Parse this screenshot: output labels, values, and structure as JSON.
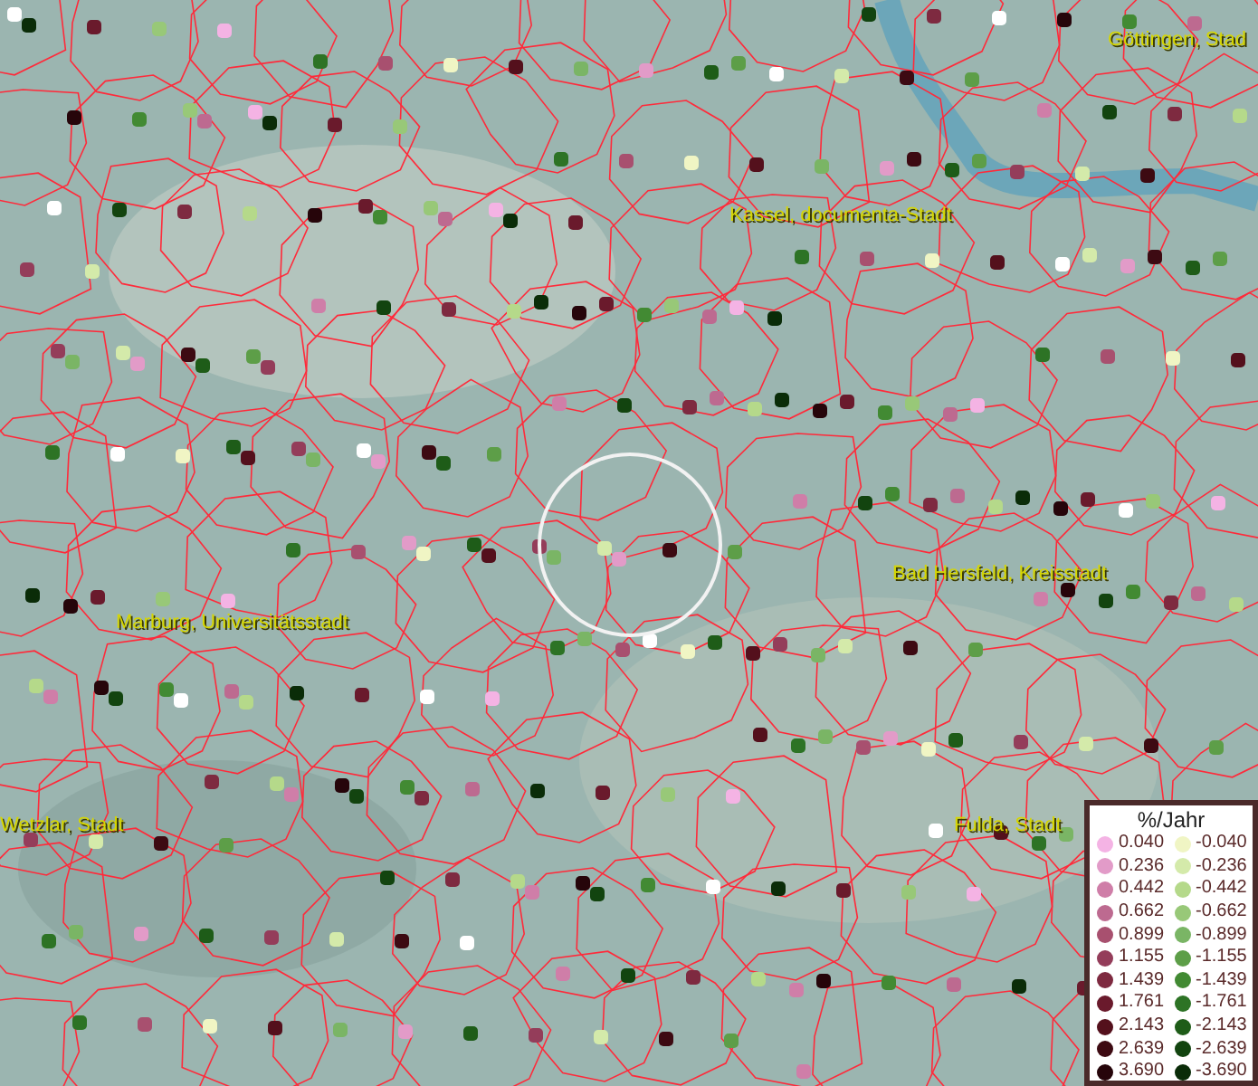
{
  "map": {
    "places": [
      {
        "name": "Göttingen, Stad"
      },
      {
        "name": "Kassel, documenta-Stadt"
      },
      {
        "name": "Marburg, Universitätsstadt"
      },
      {
        "name": "Bad Hersfeld, Kreisstadt"
      },
      {
        "name": "Wetzlar, Stadt"
      },
      {
        "name": "Fulda, Stadt"
      }
    ]
  },
  "legend": {
    "title": "%/Jahr",
    "entries": [
      {
        "label": "0.040",
        "color": "#f4b3e4"
      },
      {
        "label": "-0.040",
        "color": "#f0f5c4"
      },
      {
        "label": "0.236",
        "color": "#e29bc8"
      },
      {
        "label": "-0.236",
        "color": "#d4eaaa"
      },
      {
        "label": "0.442",
        "color": "#cf7ea8"
      },
      {
        "label": "-0.442",
        "color": "#b5d98a"
      },
      {
        "label": "0.662",
        "color": "#bd6a90"
      },
      {
        "label": "-0.662",
        "color": "#98c878"
      },
      {
        "label": "0.899",
        "color": "#a8506f"
      },
      {
        "label": "-0.899",
        "color": "#7ab565"
      },
      {
        "label": "1.155",
        "color": "#943d5a"
      },
      {
        "label": "-1.155",
        "color": "#5d9e48"
      },
      {
        "label": "1.439",
        "color": "#7e2a40"
      },
      {
        "label": "-1.439",
        "color": "#428a33"
      },
      {
        "label": "1.761",
        "color": "#6a1a2c"
      },
      {
        "label": "-1.761",
        "color": "#2d7325"
      },
      {
        "label": "2.143",
        "color": "#54101c"
      },
      {
        "label": "-2.143",
        "color": "#1e5c18"
      },
      {
        "label": "2.639",
        "color": "#3d0a12"
      },
      {
        "label": "-2.639",
        "color": "#12440f"
      },
      {
        "label": "3.690",
        "color": "#26050a"
      },
      {
        "label": "-3.690",
        "color": "#0a2c08"
      }
    ]
  }
}
